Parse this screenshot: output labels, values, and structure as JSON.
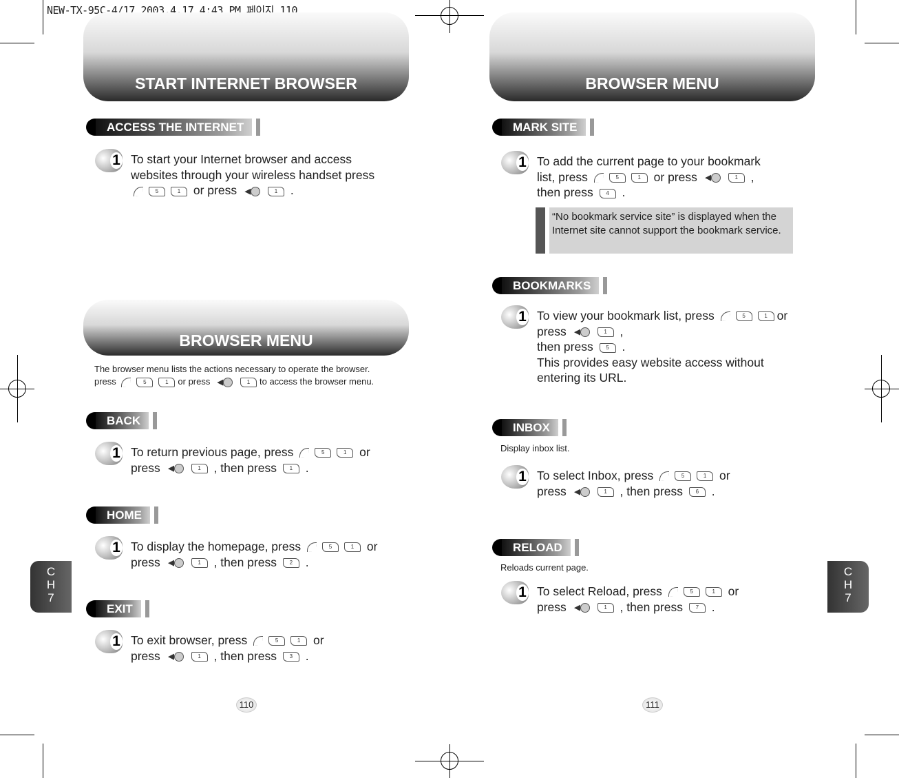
{
  "slug": "NEW-TX-95C-4/17 2003.4.17 4:43 PM 페이지 110",
  "left": {
    "header1": "START INTERNET BROWSER",
    "access": {
      "tag": "ACCESS THE INTERNET",
      "step": "1",
      "lines": [
        [
          {
            "t": "To start your Internet browser and access"
          }
        ],
        [
          {
            "t": "websites through your wireless handset press"
          }
        ],
        [
          {
            "k": "menu"
          },
          {
            "k": "5"
          },
          {
            "k": "1"
          },
          {
            "t": " or press "
          },
          {
            "k": "nav"
          },
          {
            "k": "1"
          },
          {
            "t": " ."
          }
        ]
      ]
    },
    "header2": "BROWSER MENU",
    "intro": [
      [
        {
          "t": "The browser menu lists the actions necessary to operate the browser."
        }
      ],
      [
        {
          "t": "press "
        },
        {
          "k": "menu"
        },
        {
          "k": "5"
        },
        {
          "k": "1"
        },
        {
          "t": "or press "
        },
        {
          "k": "nav"
        },
        {
          "k": "1"
        },
        {
          "t": "to access the browser menu."
        }
      ]
    ],
    "back": {
      "tag": "BACK",
      "step": "1",
      "lines": [
        [
          {
            "t": "To return previous page, press "
          },
          {
            "k": "menu"
          },
          {
            "k": "5"
          },
          {
            "k": "1"
          },
          {
            "t": " or"
          }
        ],
        [
          {
            "t": "press "
          },
          {
            "k": "nav"
          },
          {
            "k": "1"
          },
          {
            "t": " , then press "
          },
          {
            "k": "1"
          },
          {
            "t": " ."
          }
        ]
      ]
    },
    "home": {
      "tag": "HOME",
      "step": "1",
      "lines": [
        [
          {
            "t": "To display the homepage, press "
          },
          {
            "k": "menu"
          },
          {
            "k": "5"
          },
          {
            "k": "1"
          },
          {
            "t": " or"
          }
        ],
        [
          {
            "t": "press "
          },
          {
            "k": "nav"
          },
          {
            "k": "1"
          },
          {
            "t": " , then press "
          },
          {
            "k": "2"
          },
          {
            "t": " ."
          }
        ]
      ]
    },
    "exit": {
      "tag": "EXIT",
      "step": "1",
      "lines": [
        [
          {
            "t": "To exit browser, press "
          },
          {
            "k": "menu"
          },
          {
            "k": "5"
          },
          {
            "k": "1"
          },
          {
            "t": " or"
          }
        ],
        [
          {
            "t": "press "
          },
          {
            "k": "nav"
          },
          {
            "k": "1"
          },
          {
            "t": " , then press "
          },
          {
            "k": "3"
          },
          {
            "t": " ."
          }
        ]
      ]
    },
    "page": "110",
    "chapter": [
      "C",
      "H",
      "7"
    ]
  },
  "right": {
    "header": "BROWSER MENU",
    "mark": {
      "tag": "MARK SITE",
      "step": "1",
      "lines": [
        [
          {
            "t": "To add the current page to your bookmark"
          }
        ],
        [
          {
            "t": "list, press "
          },
          {
            "k": "menu"
          },
          {
            "k": "5"
          },
          {
            "k": "1"
          },
          {
            "t": " or press "
          },
          {
            "k": "nav"
          },
          {
            "k": "1"
          },
          {
            "t": " ,"
          }
        ],
        [
          {
            "t": "then press "
          },
          {
            "k": "4"
          },
          {
            "t": " ."
          }
        ]
      ]
    },
    "note": "“No bookmark service site” is displayed when the Internet site cannot support the bookmark service.",
    "bookmarks": {
      "tag": "BOOKMARKS",
      "step": "1",
      "lines": [
        [
          {
            "t": "To view your bookmark list, press "
          },
          {
            "k": "menu"
          },
          {
            "k": "5"
          },
          {
            "k": "1"
          },
          {
            "t": "or"
          }
        ],
        [
          {
            "t": "press "
          },
          {
            "k": "nav"
          },
          {
            "k": "1"
          },
          {
            "t": " ,"
          }
        ],
        [
          {
            "t": "then press "
          },
          {
            "k": "5"
          },
          {
            "t": " ."
          }
        ],
        [
          {
            "t": "This provides easy website access without"
          }
        ],
        [
          {
            "t": "entering its URL."
          }
        ]
      ]
    },
    "inbox": {
      "tag": "INBOX",
      "desc": "Display inbox list.",
      "step": "1",
      "lines": [
        [
          {
            "t": "To select Inbox, press "
          },
          {
            "k": "menu"
          },
          {
            "k": "5"
          },
          {
            "k": "1"
          },
          {
            "t": " or"
          }
        ],
        [
          {
            "t": "press "
          },
          {
            "k": "nav"
          },
          {
            "k": "1"
          },
          {
            "t": " ,  then press "
          },
          {
            "k": "6"
          },
          {
            "t": " ."
          }
        ]
      ]
    },
    "reload": {
      "tag": "RELOAD",
      "desc": "Reloads current page.",
      "step": "1",
      "lines": [
        [
          {
            "t": "To select Reload, press "
          },
          {
            "k": "menu"
          },
          {
            "k": "5"
          },
          {
            "k": "1"
          },
          {
            "t": " or"
          }
        ],
        [
          {
            "t": "press "
          },
          {
            "k": "nav"
          },
          {
            "k": "1"
          },
          {
            "t": " , then press "
          },
          {
            "k": "7"
          },
          {
            "t": " ."
          }
        ]
      ]
    },
    "page": "111",
    "chapter": [
      "C",
      "H",
      "7"
    ]
  }
}
